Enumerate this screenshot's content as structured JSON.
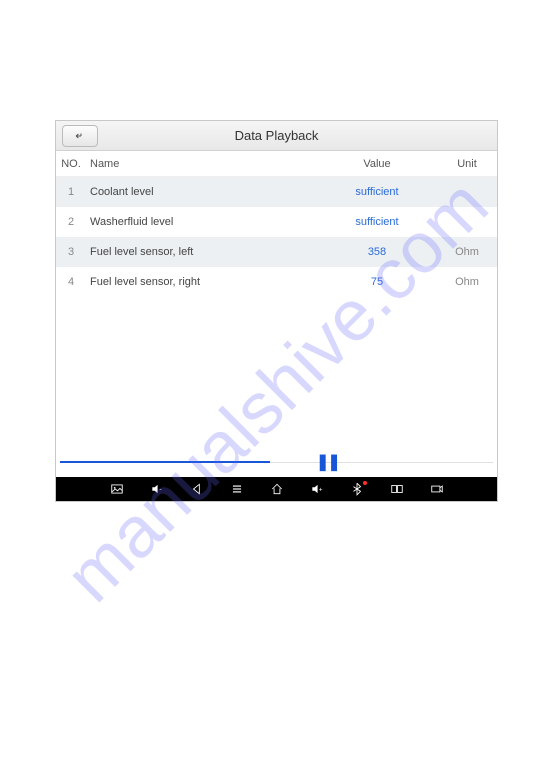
{
  "watermark": "manualshive.com",
  "header": {
    "title": "Data Playback"
  },
  "table": {
    "headers": {
      "no": "NO.",
      "name": "Name",
      "value": "Value",
      "unit": "Unit"
    },
    "rows": [
      {
        "no": "1",
        "name": "Coolant level",
        "value": "sufficient",
        "unit": ""
      },
      {
        "no": "2",
        "name": "Washerfluid level",
        "value": "sufficient",
        "unit": ""
      },
      {
        "no": "3",
        "name": "Fuel level sensor, left",
        "value": "358",
        "unit": "Ohm"
      },
      {
        "no": "4",
        "name": "Fuel level sensor, right",
        "value": "75",
        "unit": "Ohm"
      }
    ]
  },
  "navbar": {
    "icons": [
      "image-icon",
      "volume-down-icon",
      "back-nav-icon",
      "menu-icon",
      "home-icon",
      "volume-up-icon",
      "bluetooth-icon",
      "app-switch-icon",
      "camera-icon"
    ]
  }
}
